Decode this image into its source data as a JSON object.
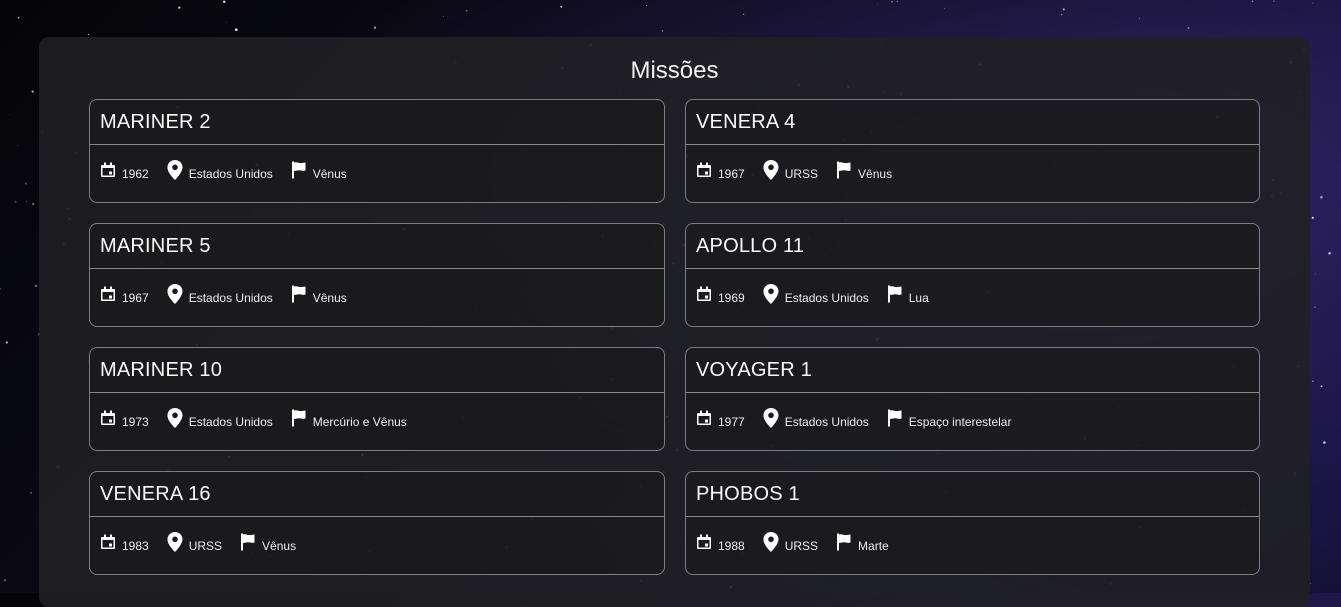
{
  "page": {
    "title": "Missões"
  },
  "missions": [
    {
      "name": "MARINER 2",
      "year": "1962",
      "country": "Estados Unidos",
      "target": "Vênus"
    },
    {
      "name": "VENERA 4",
      "year": "1967",
      "country": "URSS",
      "target": "Vênus"
    },
    {
      "name": "MARINER 5",
      "year": "1967",
      "country": "Estados Unidos",
      "target": "Vênus"
    },
    {
      "name": "APOLLO 11",
      "year": "1969",
      "country": "Estados Unidos",
      "target": "Lua"
    },
    {
      "name": "MARINER 10",
      "year": "1973",
      "country": "Estados Unidos",
      "target": "Mercúrio e Vênus"
    },
    {
      "name": "VOYAGER 1",
      "year": "1977",
      "country": "Estados Unidos",
      "target": "Espaço interestelar"
    },
    {
      "name": "VENERA 16",
      "year": "1983",
      "country": "URSS",
      "target": "Vênus"
    },
    {
      "name": "PHOBOS 1",
      "year": "1988",
      "country": "URSS",
      "target": "Marte"
    }
  ],
  "icons": {
    "year": "calendar-icon",
    "country": "location-pin-icon",
    "target": "flag-icon"
  }
}
